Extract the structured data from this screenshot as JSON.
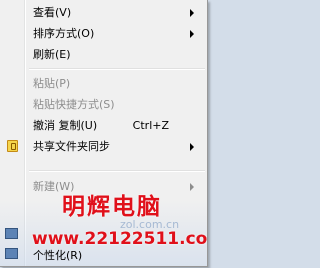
{
  "menu": {
    "items": [
      {
        "label": "查看(V)",
        "shortcut": "",
        "submenu": true,
        "disabled": false
      },
      {
        "label": "排序方式(O)",
        "shortcut": "",
        "submenu": true,
        "disabled": false
      },
      {
        "label": "刷新(E)",
        "shortcut": "",
        "submenu": false,
        "disabled": false
      },
      {
        "label": "粘贴(P)",
        "shortcut": "",
        "submenu": false,
        "disabled": true
      },
      {
        "label": "粘贴快捷方式(S)",
        "shortcut": "",
        "submenu": false,
        "disabled": true
      },
      {
        "label": "撤消 复制(U)",
        "shortcut": "Ctrl+Z",
        "submenu": false,
        "disabled": false
      },
      {
        "label": "共享文件夹同步",
        "shortcut": "",
        "submenu": true,
        "disabled": false,
        "icon": "folder-sync-icon"
      },
      {
        "label": "新建(W)",
        "shortcut": "",
        "submenu": true,
        "disabled": true
      },
      {
        "label": "个性化(R)",
        "shortcut": "",
        "submenu": false,
        "disabled": false
      }
    ]
  },
  "watermark": {
    "title": "明辉电脑",
    "url": "www.22122511.com",
    "faint": "zol.com.cn"
  },
  "colors": {
    "menu_bg": "#f0f0f0",
    "disabled_text": "#8d8d8d",
    "watermark_red": "#e0101a"
  }
}
